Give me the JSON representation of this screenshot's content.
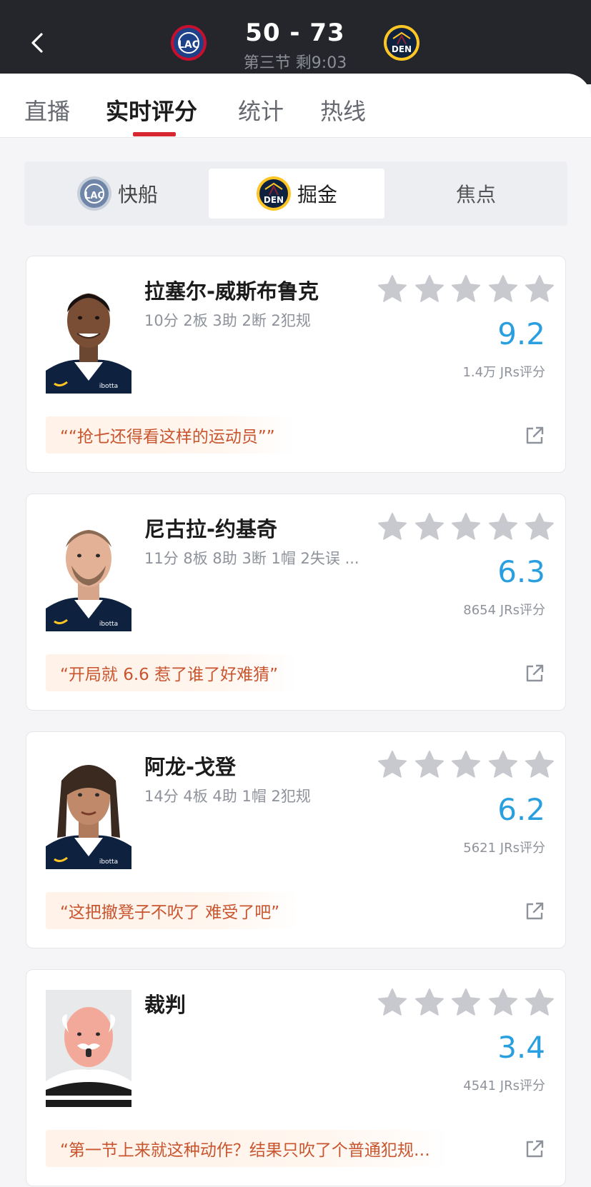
{
  "header": {
    "score": "50 - 73",
    "period": "第三节 剩9:03",
    "home_logo_text": "LAC",
    "away_logo_text": "DEN",
    "home_color": "#1d428a",
    "away_color": "#fec524"
  },
  "tabs": [
    {
      "label": "直播",
      "active": false
    },
    {
      "label": "实时评分",
      "active": true
    },
    {
      "label": "统计",
      "active": false
    },
    {
      "label": "热线",
      "active": false
    }
  ],
  "segment": [
    {
      "label": "快船",
      "icon": "lac-logo-icon",
      "selected": false
    },
    {
      "label": "掘金",
      "icon": "den-logo-icon",
      "selected": true
    },
    {
      "label": "焦点",
      "icon": "",
      "selected": false
    }
  ],
  "players": [
    {
      "name": "拉塞尔-威斯布鲁克",
      "stats": "10分 2板 3助 2断 2犯规",
      "rating": "9.2",
      "count": "1.4万 JRs评分",
      "quote": "““抢七还得看这样的运动员””",
      "stars_filled": 0
    },
    {
      "name": "尼古拉-约基奇",
      "stats": "11分 8板 8助 3断 1帽 2失误 ...",
      "rating": "6.3",
      "count": "8654 JRs评分",
      "quote": "“开局就 6.6 惹了谁了好难猜”",
      "stars_filled": 0
    },
    {
      "name": "阿龙-戈登",
      "stats": "14分 4板 4助 1帽 2犯规",
      "rating": "6.2",
      "count": "5621 JRs评分",
      "quote": "“这把撤凳子不吹了 难受了吧”",
      "stars_filled": 0
    },
    {
      "name": "裁判",
      "stats": "",
      "rating": "3.4",
      "count": "4541 JRs评分",
      "quote": "“第一节上来就这种动作？结果只吹了个普通犯规…",
      "stars_filled": 0
    }
  ],
  "colors": {
    "accent_red": "#d92731",
    "rating_blue": "#2a9fe0",
    "quote_orange": "#c9552f",
    "star_gray": "#c7c9ce",
    "header_bg": "#24262b"
  }
}
